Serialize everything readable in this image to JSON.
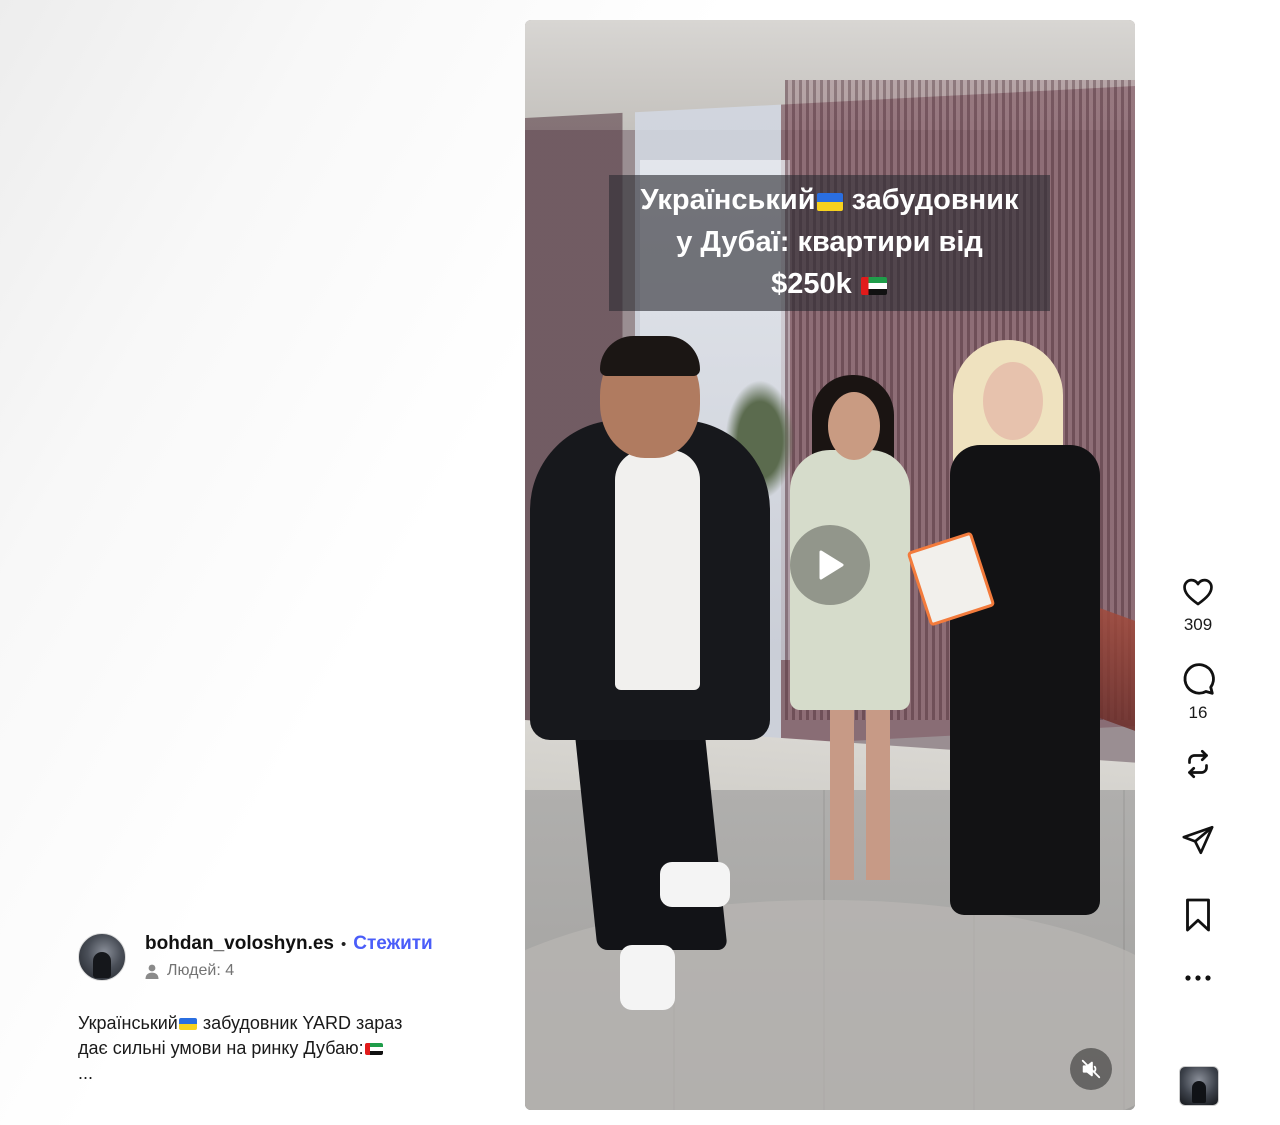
{
  "post": {
    "username": "bohdan_voloshyn.es",
    "separator": "•",
    "follow_label": "Стежити",
    "people_label": "Людей: 4",
    "caption": {
      "line1_pre": "Український",
      "line1_post": " забудовник YARD зараз",
      "line2": "дає сильні умови на ринку Дубаю:",
      "line3": "..."
    }
  },
  "video": {
    "overlay": {
      "line1_pre": "Український",
      "line1_post": " забудовник",
      "line2": "у Дубаї: квартири від",
      "line3": "$250k "
    },
    "state": "paused",
    "muted": true
  },
  "actions": {
    "likes": "309",
    "comments": "16"
  },
  "icons": {
    "like": "heart-icon",
    "comment": "comment-icon",
    "repost": "repost-icon",
    "share": "share-icon",
    "save": "bookmark-icon",
    "more": "more-icon",
    "play": "play-icon",
    "mute": "muted-speaker-icon"
  },
  "colors": {
    "accent": "#4a5df9",
    "text": "#1a1a1a",
    "muted": "#737373"
  }
}
